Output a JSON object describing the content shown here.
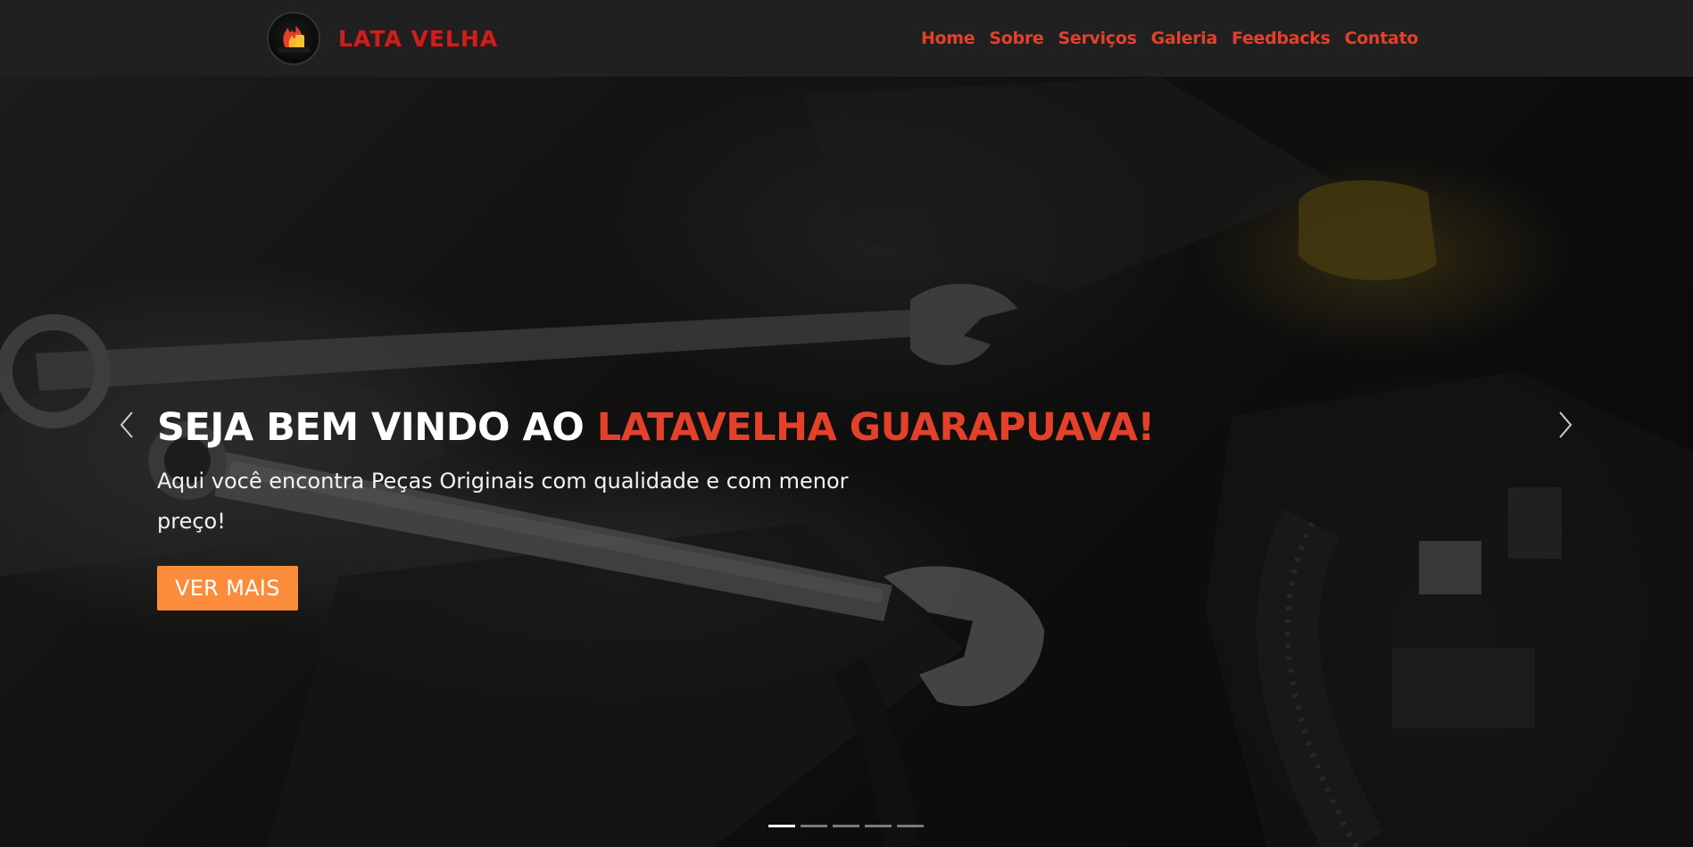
{
  "header": {
    "brand_name": "LATA VELHA",
    "logo_text": "LATA VELHA",
    "nav": [
      {
        "label": "Home"
      },
      {
        "label": "Sobre"
      },
      {
        "label": "Serviços"
      },
      {
        "label": "Galeria"
      },
      {
        "label": "Feedbacks"
      },
      {
        "label": "Contato"
      }
    ]
  },
  "hero": {
    "title_prefix": "SEJA BEM VINDO AO ",
    "title_accent": "LATAVELHA GUARAPUAVA!",
    "subtitle": "Aqui você encontra Peças Originais com qualidade e com menor preço!",
    "cta_label": "VER MAIS",
    "prev_icon": "chevron-left-icon",
    "next_icon": "chevron-right-icon",
    "slides_total": 5,
    "active_slide": 1
  },
  "colors": {
    "accent": "#e4412b",
    "brand_red": "#c9201e",
    "cta": "#fb8c3b",
    "navbar_bg": "#202020"
  }
}
